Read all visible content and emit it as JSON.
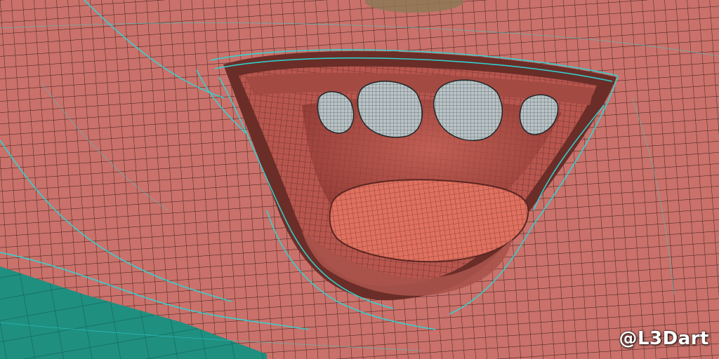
{
  "scene": {
    "subject": "wireframe-mouth",
    "colors": {
      "skin": "#c9716a",
      "skin_dark": "#8d463f",
      "mesh_dark": "#3a1c1a",
      "mesh_cyan": "#2fd6d6",
      "inner_mouth": "#b8564e",
      "throat": "#7f2f2a",
      "tongue": "#e0705f",
      "teeth": "#b9c3c6",
      "ground_teal": "#1f8f80"
    }
  },
  "watermark": {
    "text": "@L3Dart"
  }
}
